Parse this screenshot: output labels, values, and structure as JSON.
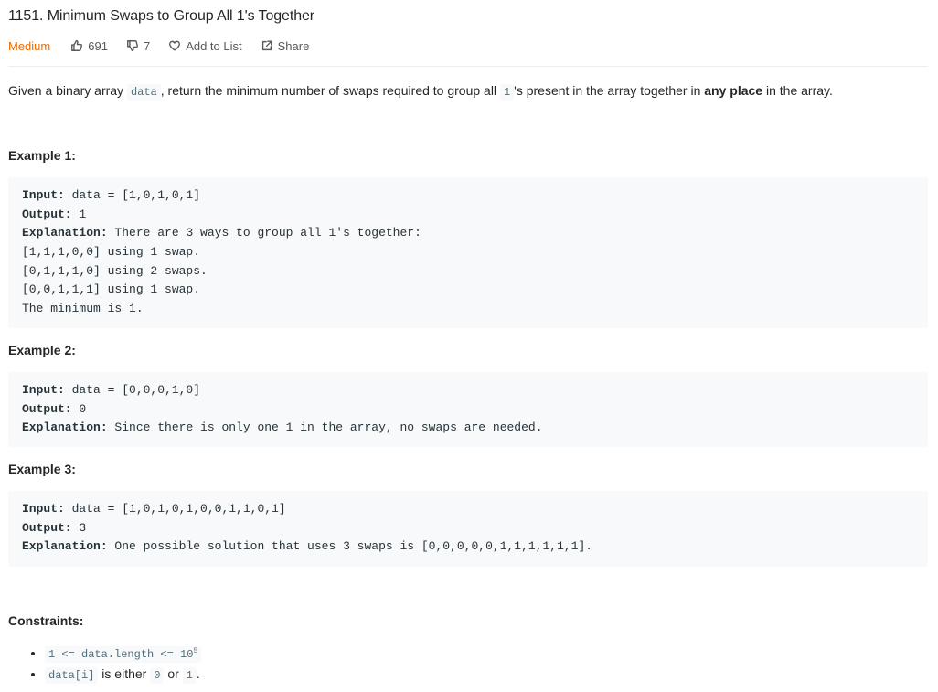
{
  "problem": {
    "title": "1151. Minimum Swaps to Group All 1's Together",
    "difficulty": "Medium",
    "likes": "691",
    "dislikes": "7",
    "add_to_list": "Add to List",
    "share": "Share"
  },
  "description": {
    "part1": "Given a binary array ",
    "code1": "data",
    "part2": ", return the minimum number of swaps required to group all ",
    "code2": "1",
    "part3": "'s present in the array together in ",
    "bold": "any place",
    "part4": " in the array."
  },
  "examples": [
    {
      "heading": "Example 1:",
      "input_label": "Input:",
      "input": " data = [1,0,1,0,1]",
      "output_label": "Output:",
      "output": " 1",
      "explanation_label": "Explanation:",
      "explanation": " There are 3 ways to group all 1's together:",
      "extra": [
        "[1,1,1,0,0] using 1 swap.",
        "[0,1,1,1,0] using 2 swaps.",
        "[0,0,1,1,1] using 1 swap.",
        "The minimum is 1."
      ]
    },
    {
      "heading": "Example 2:",
      "input_label": "Input:",
      "input": " data = [0,0,0,1,0]",
      "output_label": "Output:",
      "output": " 0",
      "explanation_label": "Explanation:",
      "explanation": " Since there is only one 1 in the array, no swaps are needed."
    },
    {
      "heading": "Example 3:",
      "input_label": "Input:",
      "input": " data = [1,0,1,0,1,0,0,1,1,0,1]",
      "output_label": "Output:",
      "output": " 3",
      "explanation_label": "Explanation:",
      "explanation": " One possible solution that uses 3 swaps is [0,0,0,0,0,1,1,1,1,1,1]."
    }
  ],
  "constraints": {
    "heading": "Constraints:",
    "c1_code": "1 <= data.length <= 10",
    "c1_sup": "5",
    "c2_code": "data[i]",
    "c2_text1": " is either ",
    "c2_code2": "0",
    "c2_text2": " or ",
    "c2_code3": "1",
    "c2_text3": "."
  },
  "icons": {
    "like": "thumbs-up-icon",
    "dislike": "thumbs-down-icon",
    "add_to_list": "heart-icon",
    "share": "share-icon"
  },
  "colors": {
    "difficulty": "#ef6c00",
    "code_bg": "#f7f9fa",
    "inline_code": "#546e7a"
  }
}
